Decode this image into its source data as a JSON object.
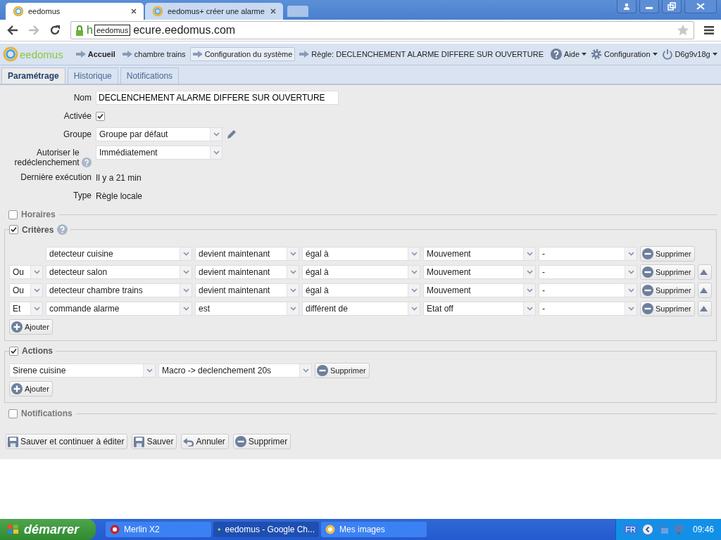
{
  "browser": {
    "tabs": [
      {
        "title": "eedomus",
        "selected": true
      },
      {
        "title": "eedomus+ créer une alarme",
        "selected": false
      }
    ],
    "address": {
      "url_start": "h",
      "tooltip": "eedomus",
      "url_end": "ecure.eedomus.com"
    }
  },
  "app": {
    "logo": "eedomus",
    "breadcrumbs": [
      {
        "label": "Accueil",
        "bold": true,
        "selected": false
      },
      {
        "label": "chambre trains",
        "bold": false,
        "selected": false
      },
      {
        "label": "Configuration du système",
        "bold": false,
        "selected": true
      },
      {
        "label": "Règle: DECLENCHEMENT ALARME DIFFERE SUR OUVERTURE",
        "bold": false,
        "selected": false
      }
    ],
    "menus": [
      {
        "kind": "help",
        "label": "Aide"
      },
      {
        "kind": "settings",
        "label": "Configuration"
      },
      {
        "kind": "user",
        "label": "D6g9v18g"
      }
    ]
  },
  "tabs": [
    {
      "label": "Paramétrage",
      "selected": true
    },
    {
      "label": "Historique",
      "selected": false
    },
    {
      "label": "Notifications",
      "selected": false
    }
  ],
  "form": {
    "fields": [
      {
        "kind": "text",
        "label": "Nom",
        "value": "DECLENCHEMENT ALARME DIFFERE SUR OUVERTURE"
      },
      {
        "kind": "checkbox",
        "label": "Activée",
        "checked": true
      },
      {
        "kind": "select",
        "label": "Groupe",
        "value": "Groupe par défaut",
        "edit_button": true
      },
      {
        "kind": "select",
        "label": "Autoriser le redéclenchement",
        "value": "Immédiatement",
        "help": true
      },
      {
        "kind": "info",
        "label": "Dernière exécution",
        "value": "Il y a 21 min"
      },
      {
        "kind": "info",
        "label": "Type",
        "value": "Règle locale"
      }
    ]
  },
  "sections": [
    {
      "title": "Horaires",
      "checked": false
    },
    {
      "kind": "criteria",
      "title": "Critères",
      "checked": true,
      "help": true,
      "add_label": "Ajouter",
      "rows": [
        {
          "device": "detecteur cuisine",
          "operator": "devient maintenant",
          "comparator": "égal à",
          "value": "Mouvement",
          "extra": "-",
          "delete_label": "Supprimer",
          "move_up": false
        },
        {
          "connector": "Ou",
          "device": "detecteur salon",
          "operator": "devient maintenant",
          "comparator": "égal à",
          "value": "Mouvement",
          "extra": "-",
          "delete_label": "Supprimer",
          "move_up": true
        },
        {
          "connector": "Ou",
          "device": "detecteur chambre trains",
          "operator": "devient maintenant",
          "comparator": "égal à",
          "value": "Mouvement",
          "extra": "-",
          "delete_label": "Supprimer",
          "move_up": true
        },
        {
          "connector": "Et",
          "device": "commande alarme",
          "operator": "est",
          "comparator": "différent de",
          "value": "Etat off",
          "extra": "-",
          "delete_label": "Supprimer",
          "move_up": true
        }
      ]
    },
    {
      "kind": "actions",
      "title": "Actions",
      "checked": true,
      "add_label": "Ajouter",
      "rows": [
        {
          "device": "Sirene cuisine",
          "action": "Macro -> declenchement 20s",
          "delete_label": "Supprimer"
        }
      ]
    },
    {
      "title": "Notifications",
      "checked": false
    }
  ],
  "footer_buttons": [
    {
      "kind": "save_continue",
      "label": "Sauver et continuer à éditer"
    },
    {
      "kind": "save",
      "label": "Sauver"
    },
    {
      "kind": "cancel",
      "label": "Annuler"
    },
    {
      "kind": "delete",
      "label": "Supprimer"
    }
  ],
  "taskbar": {
    "start": "démarrer",
    "items": [
      {
        "label": "Merlin X2",
        "selected": false
      },
      {
        "label": "eedomus - Google Ch...",
        "selected": true
      },
      {
        "label": "Mes images",
        "selected": false
      }
    ],
    "language": "FR",
    "clock": "09:46"
  }
}
